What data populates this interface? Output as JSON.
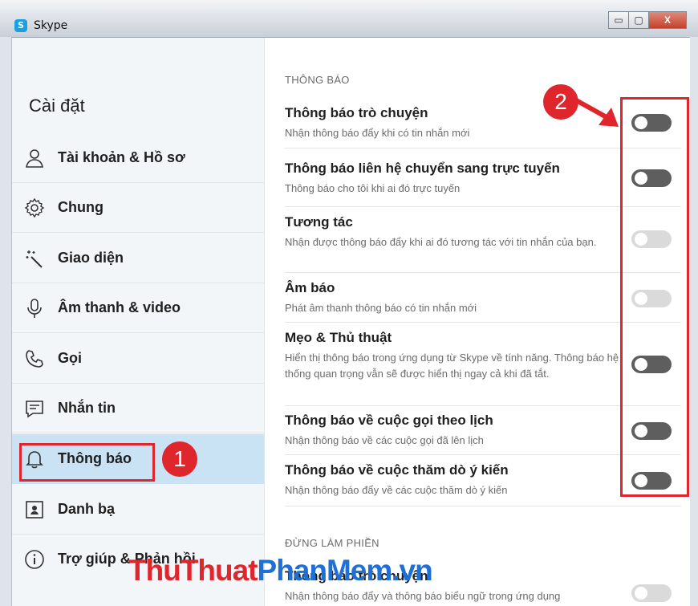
{
  "window": {
    "title": "Skype",
    "app_icon_letter": "S",
    "minimize_glyph": "▭",
    "maximize_glyph": "▢",
    "close_glyph": "X"
  },
  "sidebar": {
    "title": "Cài đặt",
    "items": [
      {
        "label": "Tài khoản & Hồ sơ",
        "icon": "person-icon"
      },
      {
        "label": "Chung",
        "icon": "gear-icon"
      },
      {
        "label": "Giao diện",
        "icon": "magic-wand-icon"
      },
      {
        "label": "Âm thanh & video",
        "icon": "microphone-icon"
      },
      {
        "label": "Gọi",
        "icon": "phone-icon"
      },
      {
        "label": "Nhắn tin",
        "icon": "message-icon"
      },
      {
        "label": "Thông báo",
        "icon": "bell-icon",
        "active": true
      },
      {
        "label": "Danh bạ",
        "icon": "contact-card-icon"
      },
      {
        "label": "Trợ giúp & Phản hồi",
        "icon": "info-icon"
      }
    ]
  },
  "main": {
    "section1_heading": "THÔNG BÁO",
    "rows": [
      {
        "title": "Thông báo trò chuyện",
        "desc": "Nhận thông báo đẩy khi có tin nhắn mới",
        "state": "on"
      },
      {
        "title": "Thông báo liên hệ chuyển sang trực tuyến",
        "desc": "Thông báo cho tôi khi ai đó trực tuyến",
        "state": "on"
      },
      {
        "title": "Tương tác",
        "desc": "Nhận được thông báo đẩy khi ai đó tương tác với tin nhắn của bạn.",
        "state": "off"
      },
      {
        "title": "Âm báo",
        "desc": "Phát âm thanh thông báo có tin nhắn mới",
        "state": "off"
      },
      {
        "title": "Mẹo & Thủ thuật",
        "desc": "Hiển thị thông báo trong ứng dụng từ Skype về tính năng. Thông báo hệ thống quan trọng vẫn sẽ được hiển thị ngay cả khi đã tắt.",
        "state": "on"
      },
      {
        "title": "Thông báo về cuộc gọi theo lịch",
        "desc": "Nhận thông báo về các cuộc gọi đã lên lịch",
        "state": "on"
      },
      {
        "title": "Thông báo về cuộc thăm dò ý kiến",
        "desc": "Nhận thông báo đẩy về các cuộc thăm dò ý kiến",
        "state": "on"
      }
    ],
    "section2_heading": "ĐỪNG LÀM PHIỀN",
    "dnd_row": {
      "title": "Thông báo trò chuyện",
      "desc": "Nhận thông báo đẩy và thông báo biểu ngữ trong ứng dụng",
      "state": "off"
    }
  },
  "annotations": {
    "badge1": "1",
    "badge2": "2",
    "watermark_part1": "ThuThuat",
    "watermark_part2": "PhanMem",
    "watermark_part3": ".vn"
  },
  "colors": {
    "accent_red": "#e0262d",
    "active_nav": "#c9e3f5",
    "toggle_on": "#5e5e5e",
    "toggle_off": "#dadada",
    "watermark_blue": "#1e6fd6"
  }
}
